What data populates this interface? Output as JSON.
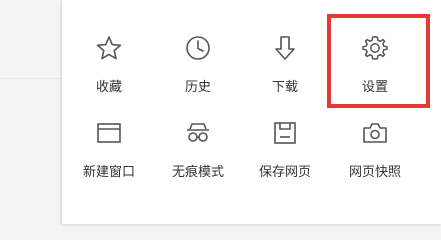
{
  "menu": {
    "items": [
      {
        "label": "收藏",
        "icon": "star-icon"
      },
      {
        "label": "历史",
        "icon": "clock-icon"
      },
      {
        "label": "下载",
        "icon": "download-arrow-icon"
      },
      {
        "label": "设置",
        "icon": "gear-icon"
      },
      {
        "label": "新建窗口",
        "icon": "new-window-icon"
      },
      {
        "label": "无痕模式",
        "icon": "incognito-glasses-icon"
      },
      {
        "label": "保存网页",
        "icon": "save-disk-icon"
      },
      {
        "label": "网页快照",
        "icon": "camera-icon"
      }
    ]
  },
  "colors": {
    "highlight_border": "#e53935",
    "icon_stroke": "#555555",
    "text": "#333333"
  }
}
